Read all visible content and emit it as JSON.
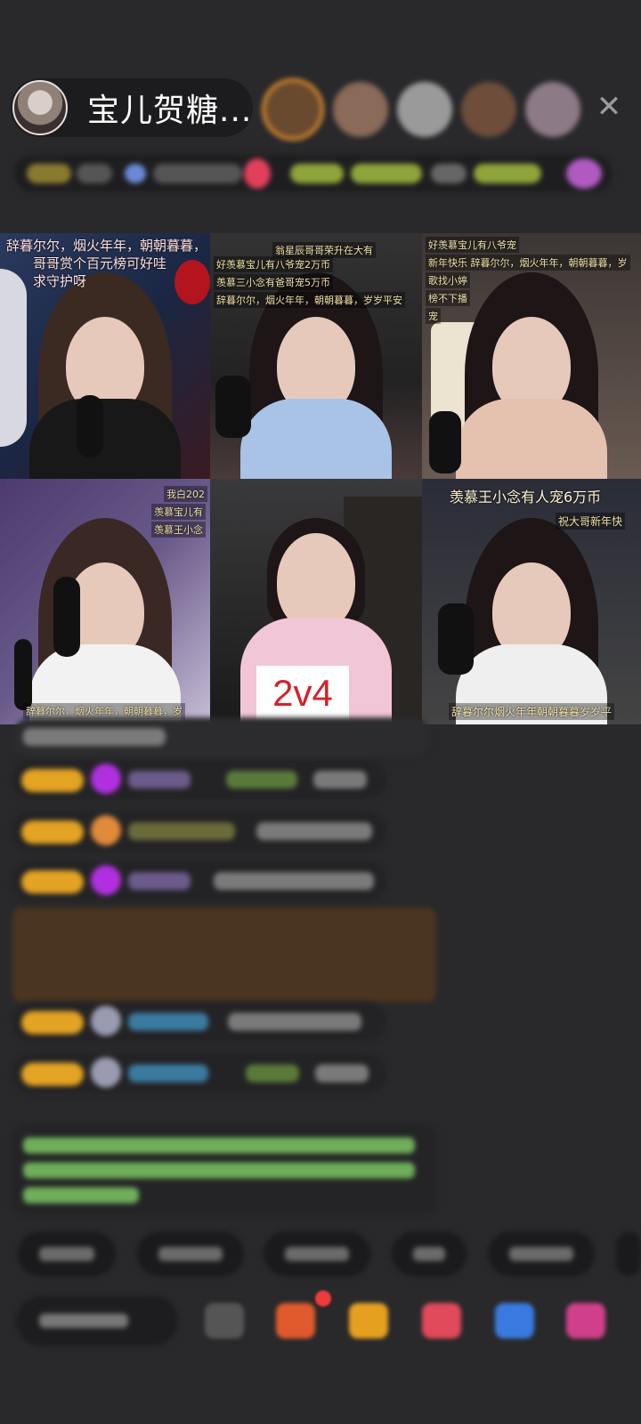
{
  "header": {
    "host_name": "宝儿贺糖...",
    "close_icon": "close-icon",
    "colors": {
      "viewer_ring": "#d98a2e"
    }
  },
  "grid": {
    "tiles": [
      {
        "overlays": [
          "辞暮尔尔，烟火年年，朝朝暮暮，",
          "哥哥赏个百元榜可好哇",
          "求守护呀"
        ]
      },
      {
        "overlays": [
          "翁星辰哥哥荣升在大有",
          "好羡慕宝儿有八爷宠2万币",
          "羡慕三小念有爸哥宠5万币",
          "辞暮尔尔，烟火年年，朝朝暮暮，岁岁平安"
        ]
      },
      {
        "overlays": [
          "好羡慕宝儿有八爷宠",
          "新年快乐  辞暮尔尔，烟火年年，朝朝暮暮，岁",
          "歌找小婷",
          "榜不下播",
          "宠"
        ]
      },
      {
        "overlays": [
          "我白202",
          "羡慕宝儿有",
          "羡慕王小念",
          "辞暮尔尔，烟火年年，朝朝暮暮，岁"
        ]
      },
      {
        "overlays": [],
        "score": "2v4"
      },
      {
        "overlays": [
          "羡慕王小念有人宠6万币",
          "祝大哥新年快",
          "辞暮尔尔烟火年年朝朝暮暮岁岁平"
        ]
      }
    ]
  }
}
